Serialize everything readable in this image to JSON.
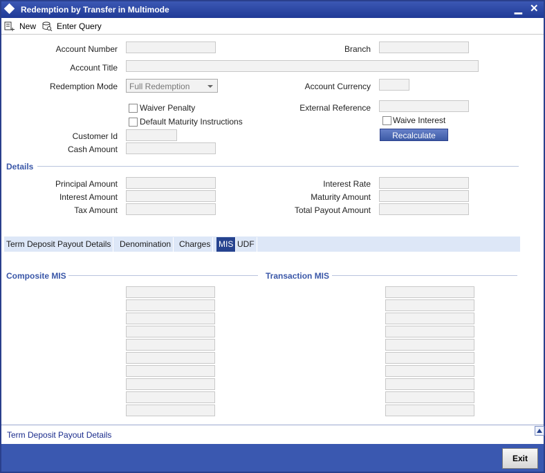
{
  "window": {
    "title": "Redemption by Transfer in Multimode"
  },
  "toolbar": {
    "new_label": "New",
    "enter_query_label": "Enter Query"
  },
  "form": {
    "account_number_label": "Account Number",
    "branch_label": "Branch",
    "account_title_label": "Account Title",
    "redemption_mode_label": "Redemption Mode",
    "redemption_mode_value": "Full Redemption",
    "account_currency_label": "Account Currency",
    "waiver_penalty_label": "Waiver Penalty",
    "external_reference_label": "External Reference",
    "default_maturity_label": "Default Maturity Instructions",
    "waive_interest_label": "Waive Interest",
    "customer_id_label": "Customer Id",
    "recalculate_label": "Recalculate",
    "cash_amount_label": "Cash Amount"
  },
  "details": {
    "title": "Details",
    "principal_amount_label": "Principal Amount",
    "interest_amount_label": "Interest Amount",
    "tax_amount_label": "Tax Amount",
    "interest_rate_label": "Interest Rate",
    "maturity_amount_label": "Maturity Amount",
    "total_payout_amount_label": "Total Payout Amount"
  },
  "tabs": [
    {
      "label": "Term Deposit Payout Details"
    },
    {
      "label": "Denomination"
    },
    {
      "label": "Charges"
    },
    {
      "label": "MIS"
    },
    {
      "label": "UDF"
    }
  ],
  "mis": {
    "composite_title": "Composite MIS",
    "transaction_title": "Transaction MIS"
  },
  "footer": {
    "link_label": "Term Deposit Payout Details",
    "exit_label": "Exit"
  },
  "colors": {
    "title_bar": "#1f3a96",
    "active_tab": "#26438f",
    "bottom_bar": "#3a58b0",
    "section_title": "#3a57a8"
  }
}
